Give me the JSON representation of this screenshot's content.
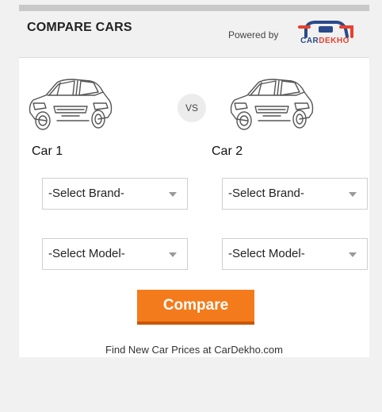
{
  "header": {
    "title": "COMPARE CARS",
    "powered_by": "Powered by",
    "logo_text_1": "CAR",
    "logo_text_2": "DEKHO"
  },
  "vs_label": "VS",
  "car1": {
    "label": "Car 1",
    "brand_select": "-Select Brand-",
    "model_select": "-Select Model-"
  },
  "car2": {
    "label": "Car 2",
    "brand_select": "-Select Brand-",
    "model_select": "-Select Model-"
  },
  "compare_button": "Compare",
  "footer_link": "Find New Car Prices at CarDekho.com",
  "colors": {
    "accent": "#f47b1b",
    "brand_blue": "#2a4a8a",
    "brand_red": "#e8402c"
  },
  "icons": {
    "left_car": "car-outline-icon",
    "right_car": "car-outline-icon",
    "dropdown": "chevron-down-icon"
  }
}
